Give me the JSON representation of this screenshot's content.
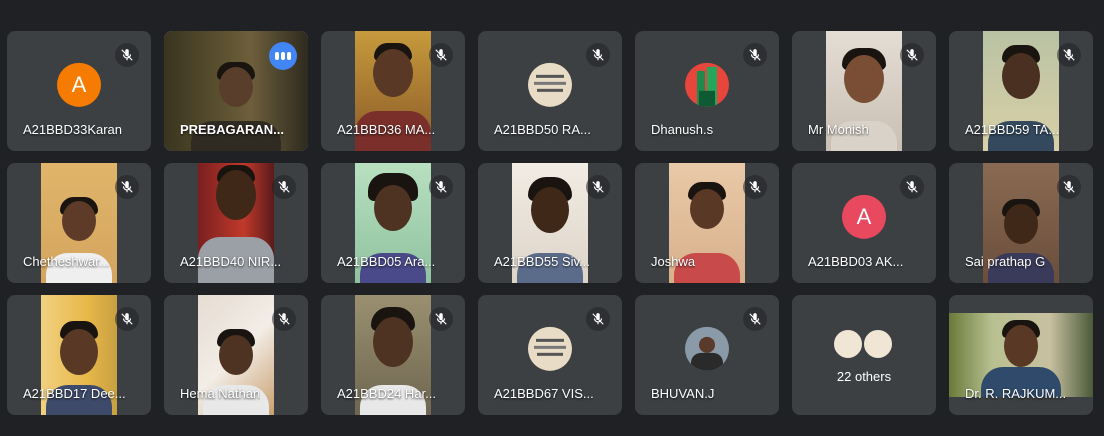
{
  "participants": [
    {
      "name": "A21BBD33Karan",
      "avatar_letter": "A",
      "avatar_color": "#f57c00"
    },
    {
      "name": "PREBAGARAN...",
      "speaking": true
    },
    {
      "name": "A21BBD36 MA..."
    },
    {
      "name": "A21BBD50 RA..."
    },
    {
      "name": "Dhanush.s"
    },
    {
      "name": "Mr Monish"
    },
    {
      "name": "A21BBD59 TA..."
    },
    {
      "name": "Chetheshwar..."
    },
    {
      "name": "A21BBD40 NIR..."
    },
    {
      "name": "A21BBD05 Ara..."
    },
    {
      "name": "A21BBD55 Siv..."
    },
    {
      "name": "Joshwa"
    },
    {
      "name": "A21BBD03 AK...",
      "avatar_letter": "A",
      "avatar_color": "#e8495f"
    },
    {
      "name": "Sai prathap G"
    },
    {
      "name": "A21BBD17 Dee..."
    },
    {
      "name": "Hema Nathan"
    },
    {
      "name": "A21BBD24 Har..."
    },
    {
      "name": "A21BBD67 VIS..."
    },
    {
      "name": "BHUVAN.J"
    }
  ],
  "others": {
    "label": "22 others"
  },
  "presenter": {
    "name": "Dr. R. RAJKUM..."
  },
  "icons": {
    "mute": "mic-off-icon",
    "speaking": "speaking-indicator-icon"
  },
  "colors": {
    "background": "#202124",
    "tile": "#3c4043",
    "speaking_border": "#8ab4f8",
    "speaking_badge": "#4285f4"
  }
}
